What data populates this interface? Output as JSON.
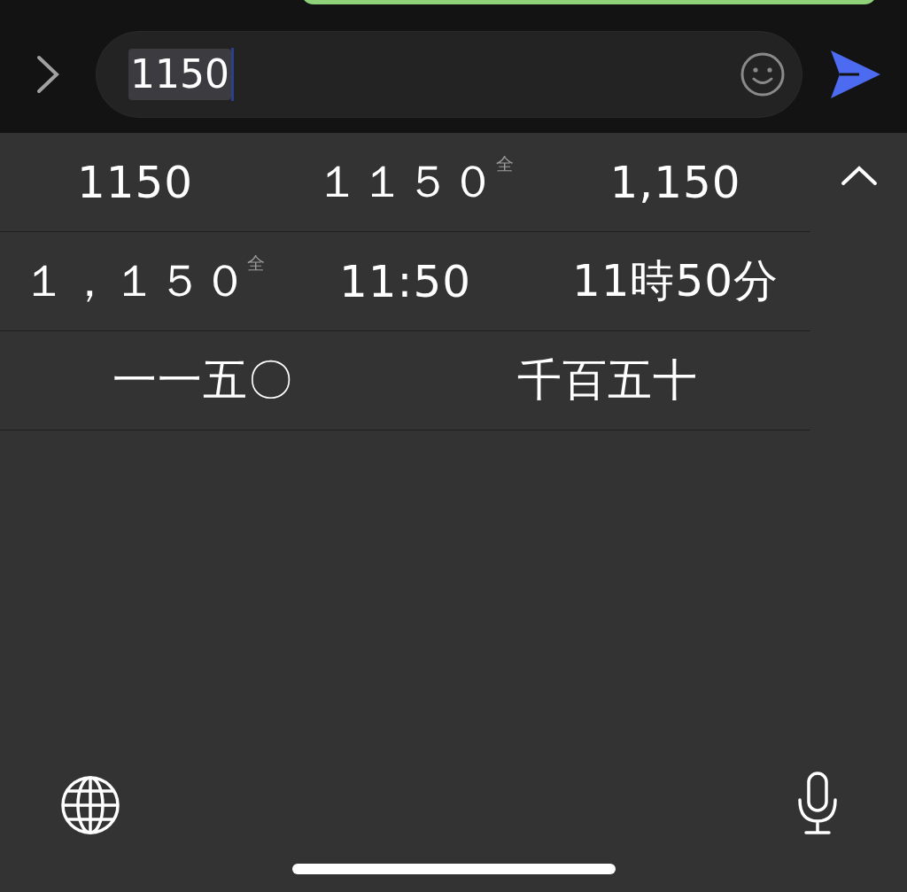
{
  "input": {
    "value": "1150",
    "selected": true
  },
  "candidate_rows": [
    {
      "candidates": [
        {
          "text": "1150"
        },
        {
          "text": "１１５０",
          "badge": "全"
        },
        {
          "text": "1,150"
        }
      ]
    },
    {
      "candidates": [
        {
          "text": "１，１５０",
          "badge": "全"
        },
        {
          "text": "11:50"
        },
        {
          "text": "11時50分"
        }
      ]
    },
    {
      "candidates": [
        {
          "text": "一一五〇"
        },
        {
          "text": "千百五十"
        }
      ]
    }
  ]
}
